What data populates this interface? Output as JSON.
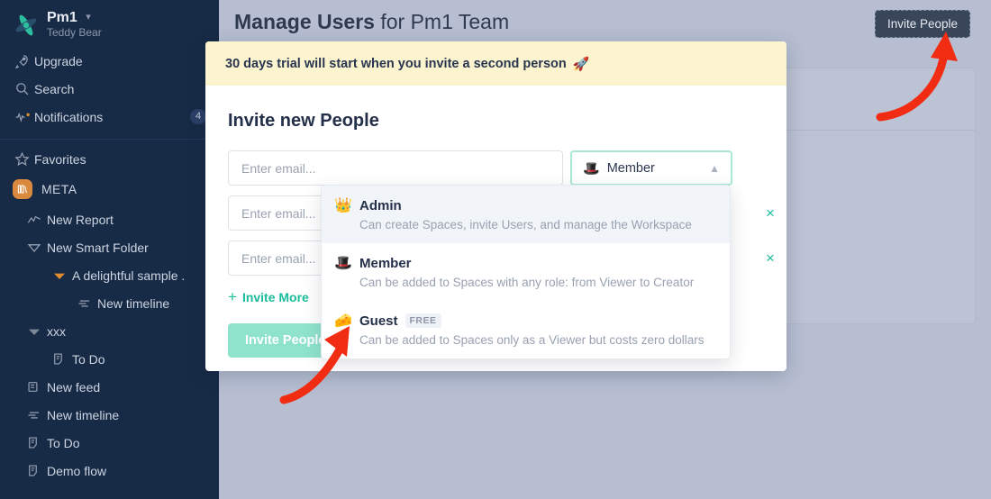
{
  "workspace": {
    "name": "Pm1",
    "subtitle": "Teddy Bear",
    "logo_icon": "app-logo-icon",
    "caret_icon": "chevron-down-icon"
  },
  "sidebar": {
    "top_items": [
      {
        "label": "Upgrade",
        "icon": "rocket-icon"
      },
      {
        "label": "Search",
        "icon": "search-icon"
      },
      {
        "label": "Notifications",
        "icon": "pulse-icon",
        "badge": "4"
      }
    ],
    "favorites": {
      "label": "Favorites",
      "icon": "star-icon"
    },
    "space": {
      "label": "META",
      "icon": "library-icon"
    },
    "tree": [
      {
        "label": "New Report",
        "icon": "chart-line-icon",
        "indent": 1
      },
      {
        "label": "New Smart Folder",
        "icon": "triangle-outline-icon",
        "indent": 1
      },
      {
        "label": "A delightful sample .",
        "icon": "triangle-filled-orange-icon",
        "indent": 2
      },
      {
        "label": "New timeline",
        "icon": "timeline-icon",
        "indent": 3
      },
      {
        "label": "xxx",
        "icon": "triangle-filled-icon",
        "indent": 1
      },
      {
        "label": "To Do",
        "icon": "todo-icon",
        "indent": 2
      },
      {
        "label": "New feed",
        "icon": "feed-icon",
        "indent": 1
      },
      {
        "label": "New timeline",
        "icon": "timeline-icon",
        "indent": 1
      },
      {
        "label": "To Do",
        "icon": "todo-icon",
        "indent": 1
      },
      {
        "label": "Demo flow",
        "icon": "todo-icon",
        "indent": 1
      }
    ]
  },
  "header": {
    "title_strong": "Manage Users",
    "title_light": " for Pm1 Team",
    "invite_button": "Invite People"
  },
  "modal": {
    "banner_text": "30 days trial will start when you invite a second person",
    "banner_emoji": "🚀",
    "title": "Invite new People",
    "email_placeholder": "Enter email...",
    "role_selected": "Member",
    "role_icon": "🎩",
    "chevron_up_icon": "∧",
    "close_icon": "×",
    "invite_more": "Invite More",
    "plus_icon": "+",
    "submit_label": "Invite People"
  },
  "dropdown": {
    "options": [
      {
        "name": "Admin",
        "icon": "👑",
        "description": "Can create Spaces, invite Users, and manage the Workspace",
        "badge": "",
        "active": true
      },
      {
        "name": "Member",
        "icon": "🎩",
        "description": "Can be added to Spaces with any role: from Viewer to Creator",
        "badge": "",
        "active": false
      },
      {
        "name": "Guest",
        "icon": "🧀",
        "description": "Can be added to Spaces only as a Viewer but costs zero dollars",
        "badge": "FREE",
        "active": false
      }
    ]
  },
  "annotations": {
    "arrow_color": "#f02d12",
    "arrow_to_header_button": "arrow-pointing-to-invite-people-button",
    "arrow_to_guest_option": "arrow-pointing-to-guest-option"
  },
  "colors": {
    "sidebar_bg": "#172a46",
    "accent_teal": "#1abc9c",
    "accent_mint": "#8fe3cd",
    "banner_bg": "#fbf4ce",
    "backdrop": "#b7bed2",
    "orange": "#d98a3f"
  }
}
